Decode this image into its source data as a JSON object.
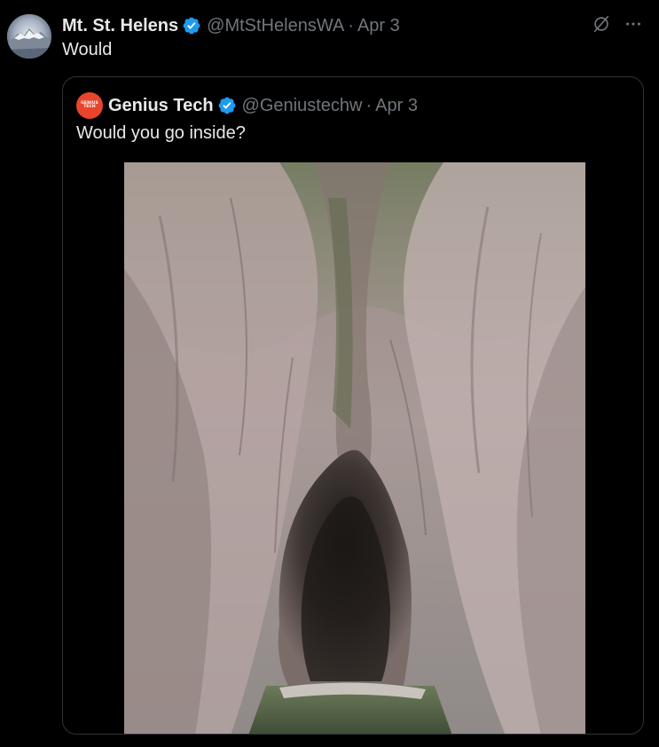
{
  "tweet": {
    "display_name": "Mt. St. Helens",
    "handle": "@MtStHelensWA",
    "separator": "·",
    "date": "Apr 3",
    "text": "Would",
    "verified": true,
    "avatar": "mountain-avatar",
    "actions": {
      "grok_icon": "grok-icon",
      "more_icon": "more-options-icon"
    }
  },
  "quoted_tweet": {
    "display_name": "Genius Tech",
    "handle": "@Geniustechw",
    "separator": "·",
    "date": "Apr 3",
    "text": "Would you go inside?",
    "verified": true,
    "avatar_text": [
      "GENIUS",
      "TECH"
    ],
    "media": {
      "type": "photo",
      "subject": "rock-canyon-cave-photo"
    }
  },
  "colors": {
    "background": "#000000",
    "text_primary": "#e7e9ea",
    "text_secondary": "#71767b",
    "border": "#2f3336",
    "verified": "#1d9bf0",
    "quote_avatar": "#e8452c"
  }
}
